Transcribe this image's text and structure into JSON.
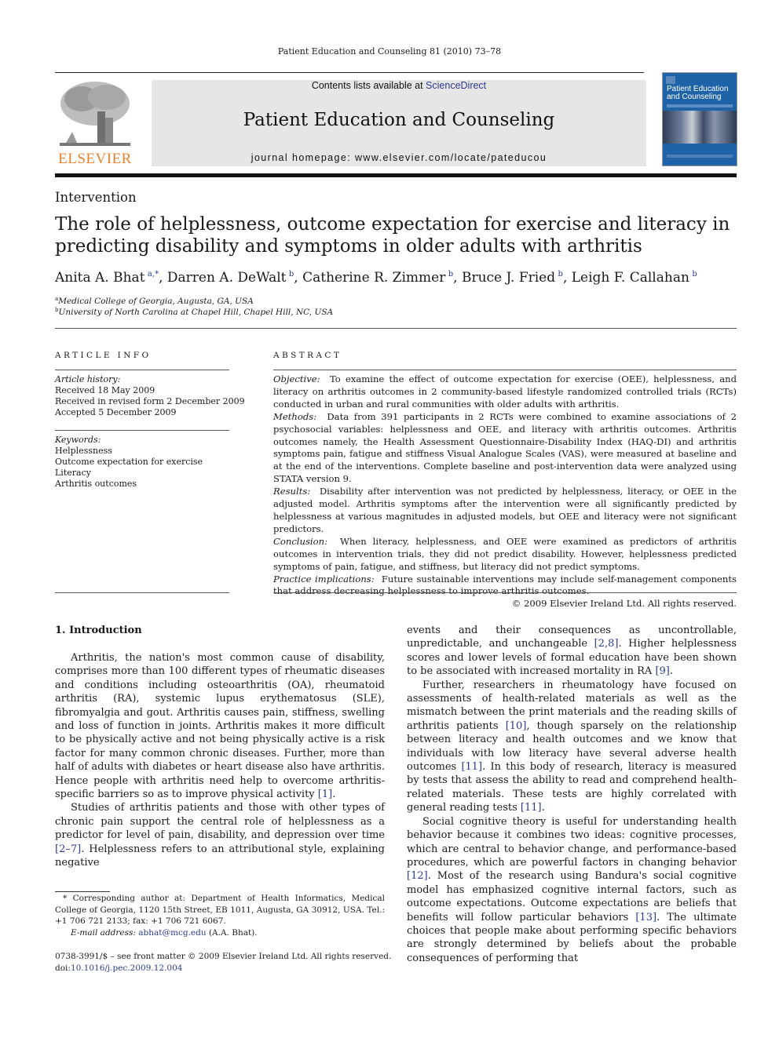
{
  "running_head": "Patient Education and Counseling 81 (2010) 73–78",
  "masthead": {
    "publisher_logo_text": "ELSEVIER",
    "contents_prefix": "Contents lists available at ",
    "contents_link": "ScienceDirect",
    "journal_title": "Patient Education and Counseling",
    "homepage_text": "journal homepage: www.elsevier.com/locate/pateducou",
    "cover_title_line1": "Patient Education",
    "cover_title_line2": "and Counseling",
    "colors": {
      "elsevier_orange": "#e8822a",
      "link_blue": "#2b3a8f",
      "banner_gray": "#e6e6e6",
      "cover_blue": "#1e63a8"
    }
  },
  "section_label": "Intervention",
  "title": "The role of helplessness, outcome expectation for exercise and literacy in predicting disability and symptoms in older adults with arthritis",
  "authors": [
    {
      "name": "Anita A. Bhat",
      "sup": "a,*"
    },
    {
      "name": "Darren A. DeWalt",
      "sup": "b"
    },
    {
      "name": "Catherine R. Zimmer",
      "sup": "b"
    },
    {
      "name": "Bruce J. Fried",
      "sup": "b"
    },
    {
      "name": "Leigh F. Callahan",
      "sup": "b"
    }
  ],
  "affiliations": [
    {
      "key": "a",
      "text": "Medical College of Georgia, Augusta, GA, USA"
    },
    {
      "key": "b",
      "text": "University of North Carolina at Chapel Hill, Chapel Hill, NC, USA"
    }
  ],
  "article_info": {
    "heading": "ARTICLE INFO",
    "history_label": "Article history:",
    "history": [
      "Received 18 May 2009",
      "Received in revised form 2 December 2009",
      "Accepted 5 December 2009"
    ],
    "keywords_label": "Keywords:",
    "keywords": [
      "Helplessness",
      "Outcome expectation for exercise",
      "Literacy",
      "Arthritis outcomes"
    ]
  },
  "abstract": {
    "heading": "ABSTRACT",
    "sections": [
      {
        "label": "Objective:",
        "text": "To examine the effect of outcome expectation for exercise (OEE), helplessness, and literacy on arthritis outcomes in 2 community-based lifestyle randomized controlled trials (RCTs) conducted in urban and rural communities with older adults with arthritis."
      },
      {
        "label": "Methods:",
        "text": "Data from 391 participants in 2 RCTs were combined to examine associations of 2 psychosocial variables: helplessness and OEE, and literacy with arthritis outcomes. Arthritis outcomes namely, the Health Assessment Questionnaire-Disability Index (HAQ-DI) and arthritis symptoms pain, fatigue and stiffness Visual Analogue Scales (VAS), were measured at baseline and at the end of the interventions. Complete baseline and post-intervention data were analyzed using STATA version 9."
      },
      {
        "label": "Results:",
        "text": "Disability after intervention was not predicted by helplessness, literacy, or OEE in the adjusted model. Arthritis symptoms after the intervention were all significantly predicted by helplessness at various magnitudes in adjusted models, but OEE and literacy were not significant predictors."
      },
      {
        "label": "Conclusion:",
        "text": "When literacy, helplessness, and OEE were examined as predictors of arthritis outcomes in intervention trials, they did not predict disability. However, helplessness predicted symptoms of pain, fatigue, and stiffness, but literacy did not predict symptoms."
      },
      {
        "label": "Practice implications:",
        "text": "Future sustainable interventions may include self-management components that address decreasing helplessness to improve arthritis outcomes."
      }
    ],
    "copyright": "© 2009 Elsevier Ireland Ltd. All rights reserved."
  },
  "introduction": {
    "heading": "1.  Introduction",
    "left_col": [
      {
        "indent": true,
        "parts": [
          {
            "t": "Arthritis, the nation's most common cause of disability, comprises more than 100 different types of rheumatic diseases and conditions including osteoarthritis (OA), rheumatoid arthritis (RA), systemic lupus erythematosus (SLE), fibromyalgia and gout. Arthritis causes pain, stiffness, swelling and loss of function in joints. Arthritis makes it more difficult to be physically active and not being physically active is a risk factor for many common chronic diseases. Further, more than half of adults with diabetes or heart disease also have arthritis. Hence people with arthritis need help to overcome arthritis-specific barriers so as to improve physical activity "
          },
          {
            "ref": "[1]"
          },
          {
            "t": "."
          }
        ]
      },
      {
        "indent": true,
        "parts": [
          {
            "t": "Studies of arthritis patients and those with other types of chronic pain support the central role of helplessness as a predictor for level of pain, disability, and depression over time "
          },
          {
            "ref": "[2–7]"
          },
          {
            "t": ". Helplessness refers to an attributional style, explaining negative"
          }
        ]
      }
    ],
    "right_col": [
      {
        "indent": false,
        "parts": [
          {
            "t": "events and their consequences as uncontrollable, unpredictable, and unchangeable "
          },
          {
            "ref": "[2,8]"
          },
          {
            "t": ". Higher helplessness scores and lower levels of formal education have been shown to be associated with increased mortality in RA "
          },
          {
            "ref": "[9]"
          },
          {
            "t": "."
          }
        ]
      },
      {
        "indent": true,
        "parts": [
          {
            "t": "Further, researchers in rheumatology have focused on assessments of health-related materials as well as the mismatch between the print materials and the reading skills of arthritis patients "
          },
          {
            "ref": "[10]"
          },
          {
            "t": ", though sparsely on the relationship between literacy and health outcomes and we know that individuals with low literacy have several adverse health outcomes "
          },
          {
            "ref": "[11]"
          },
          {
            "t": ". In this body of research, literacy is measured by tests that assess the ability to read and comprehend health-related materials. These tests are highly correlated with general reading tests "
          },
          {
            "ref": "[11]"
          },
          {
            "t": "."
          }
        ]
      },
      {
        "indent": true,
        "parts": [
          {
            "t": "Social cognitive theory is useful for understanding health behavior because it combines two ideas: cognitive processes, which are central to behavior change, and performance-based procedures, which are powerful factors in changing behavior "
          },
          {
            "ref": "[12]"
          },
          {
            "t": ". Most of the research using Bandura's social cognitive model has emphasized cognitive internal factors, such as outcome expectations. Outcome expectations are beliefs that benefits will follow particular behaviors "
          },
          {
            "ref": "[13]"
          },
          {
            "t": ". The ultimate choices that people make about performing specific behaviors are strongly determined by beliefs about the probable consequences of performing that"
          }
        ]
      }
    ]
  },
  "footnote": {
    "corresponding": "* Corresponding author at: Department of Health Informatics, Medical College of Georgia, 1120 15th Street, EB 1011, Augusta, GA 30912, USA. Tel.: +1 706 721 2133; fax: +1 706 721 6067.",
    "email_label": "E-mail address:",
    "email": "abhat@mcg.edu",
    "email_suffix": " (A.A. Bhat)."
  },
  "front_matter": {
    "issn_line": "0738-3991/$ – see front matter © 2009 Elsevier Ireland Ltd. All rights reserved.",
    "doi_prefix": "doi:",
    "doi": "10.1016/j.pec.2009.12.004"
  }
}
